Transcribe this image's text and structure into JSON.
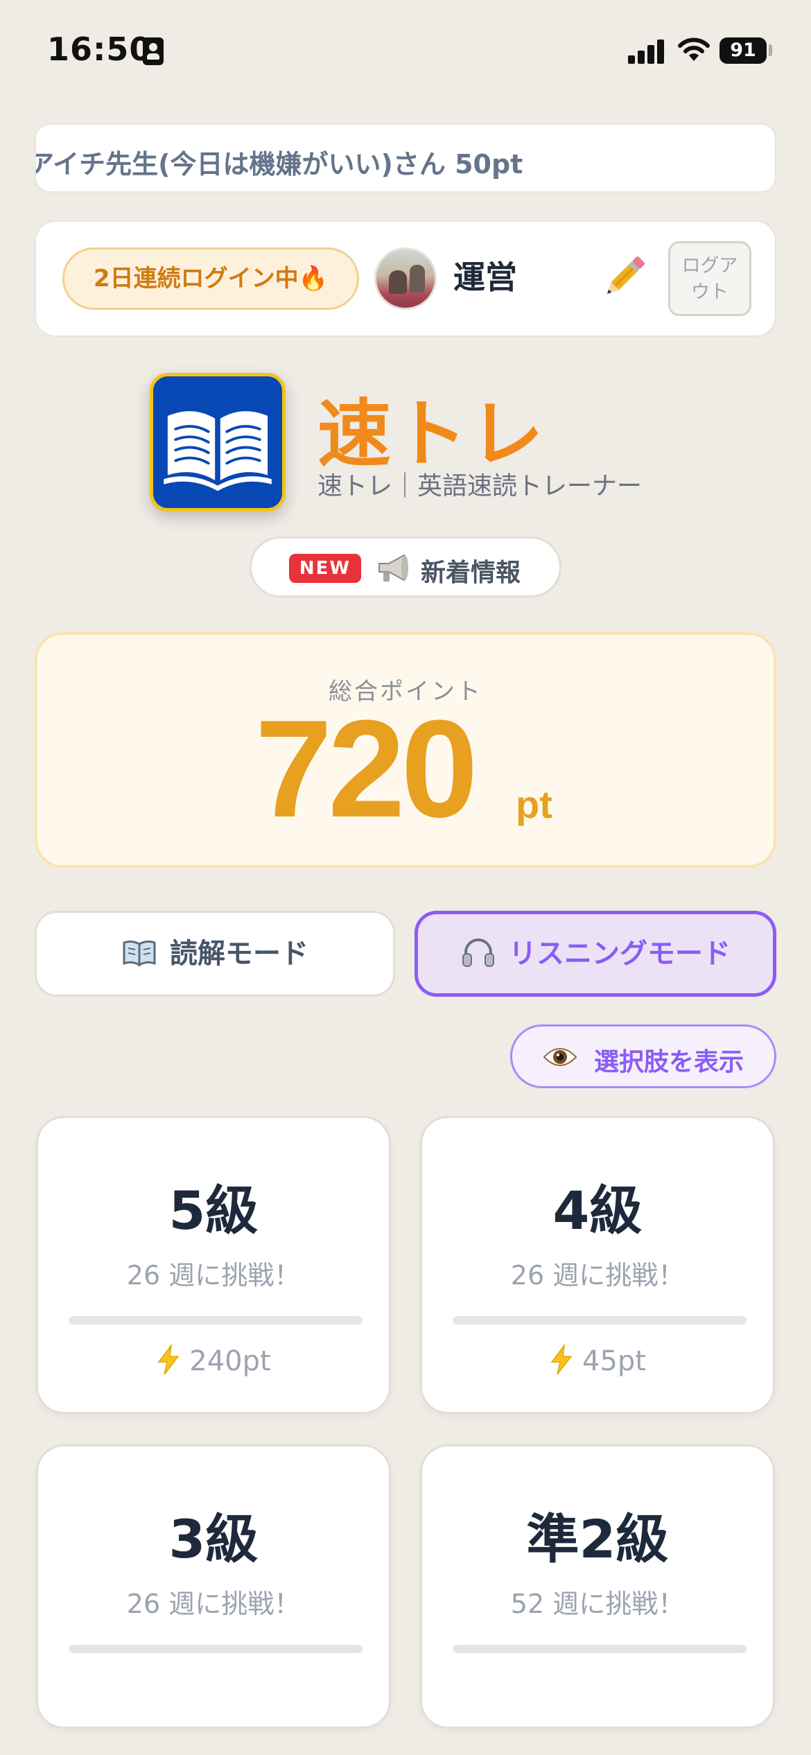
{
  "status_bar": {
    "time": "16:50",
    "battery": "91"
  },
  "marquee": {
    "text": "アイチ先生(今日は機嫌がいい)さん 50pt"
  },
  "user": {
    "streak": "2日連続ログイン中🔥",
    "name": "運営",
    "logout_line1": "ログア",
    "logout_line2": "ウト"
  },
  "brand": {
    "title": "速トレ",
    "subtitle": "速トレ｜英語速読トレーナー"
  },
  "news": {
    "badge": "NEW",
    "label": "新着情報"
  },
  "points": {
    "label": "総合ポイント",
    "value": "720",
    "unit": "pt"
  },
  "modes": {
    "reading": "読解モード",
    "listening": "リスニングモード",
    "active": "listening"
  },
  "choices_button": "選択肢を表示",
  "grades": [
    {
      "title": "5級",
      "subtitle": "26 週に挑戦！",
      "points": "240pt",
      "progress": 0
    },
    {
      "title": "4級",
      "subtitle": "26 週に挑戦！",
      "points": "45pt",
      "progress": 0
    },
    {
      "title": "3級",
      "subtitle": "26 週に挑戦！",
      "points": "",
      "progress": 0
    },
    {
      "title": "準2級",
      "subtitle": "52 週に挑戦！",
      "points": "",
      "progress": 0
    }
  ],
  "colors": {
    "accent": "#e8a020",
    "brand": "#f08a1a",
    "purple": "#8b5cf6",
    "background": "#efebe5"
  },
  "icons": [
    "id-card-icon",
    "signal-icon",
    "wifi-icon",
    "battery-icon",
    "fire-icon",
    "pencil-icon",
    "book-icon",
    "megaphone-icon",
    "headphones-icon",
    "eye-icon",
    "lightning-icon"
  ]
}
